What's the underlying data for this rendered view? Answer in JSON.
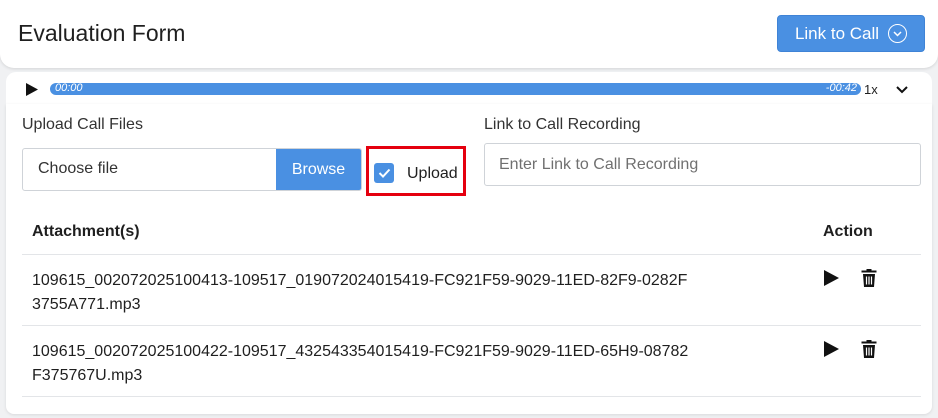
{
  "header": {
    "title": "Evaluation Form",
    "link_button_label": "Link to Call"
  },
  "player": {
    "current_time": "00:00",
    "remaining_time": "-00:42",
    "speed": "1x"
  },
  "upload": {
    "files_label": "Upload Call Files",
    "choose_file_text": "Choose file",
    "browse_label": "Browse",
    "upload_checkbox_label": "Upload",
    "upload_checked": true
  },
  "recording": {
    "label": "Link to Call Recording",
    "placeholder": "Enter Link to Call Recording"
  },
  "attachments": {
    "headers": {
      "attachment": "Attachment(s)",
      "action": "Action"
    },
    "rows": [
      {
        "filename": "109615_002072025100413-109517_019072024015419-FC921F59-9029-11ED-82F9-0282F3755A771.mp3"
      },
      {
        "filename": "109615_002072025100422-109517_432543354015419-FC921F59-9029-11ED-65H9-08782F375767U.mp3"
      }
    ]
  },
  "colors": {
    "accent": "#4a90e2",
    "highlight_border": "#e5000f"
  },
  "icons": [
    "play-icon",
    "chevron-down-icon",
    "chevron-down-circle-icon",
    "checkmark-icon",
    "trash-icon"
  ]
}
